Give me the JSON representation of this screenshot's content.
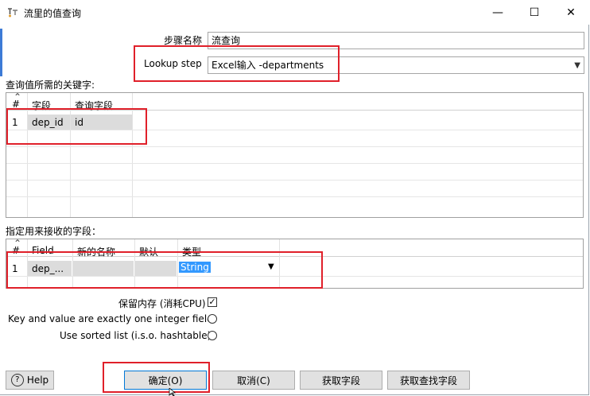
{
  "window": {
    "title": "流里的值查询",
    "controls": {
      "minimize": "—",
      "maximize": "☐",
      "close": "✕"
    }
  },
  "form": {
    "step_name_label": "步骤名称",
    "step_name_value": "流查询",
    "lookup_step_label": "Lookup step",
    "lookup_step_value": "Excel输入 -departments"
  },
  "keys_section": {
    "label": "查询值所需的关键字:",
    "headers": [
      "#",
      "字段",
      "查询字段"
    ],
    "rows": [
      {
        "num": "1",
        "field": "dep_id",
        "lookup_field": "id"
      }
    ]
  },
  "fields_section": {
    "label": "指定用来接收的字段：",
    "headers": [
      "#",
      "Field",
      "新的名称",
      "默认",
      "类型"
    ],
    "rows": [
      {
        "num": "1",
        "field": "dep_...",
        "new_name": "",
        "default": "",
        "type": "String"
      }
    ]
  },
  "options": {
    "preserve_memory_label": "保留内存 (消耗CPU)",
    "preserve_memory_checked": true,
    "integer_key_label": "Key and value are exactly one integer field",
    "sorted_list_label": "Use sorted list (i.s.o. hashtable)"
  },
  "buttons": {
    "help": "Help",
    "ok": "确定(O)",
    "cancel": "取消(C)",
    "get_fields": "获取字段",
    "get_lookup_fields": "获取查找字段"
  },
  "colors": {
    "annotation_red": "#e0202a",
    "selection_blue": "#3399ff"
  }
}
